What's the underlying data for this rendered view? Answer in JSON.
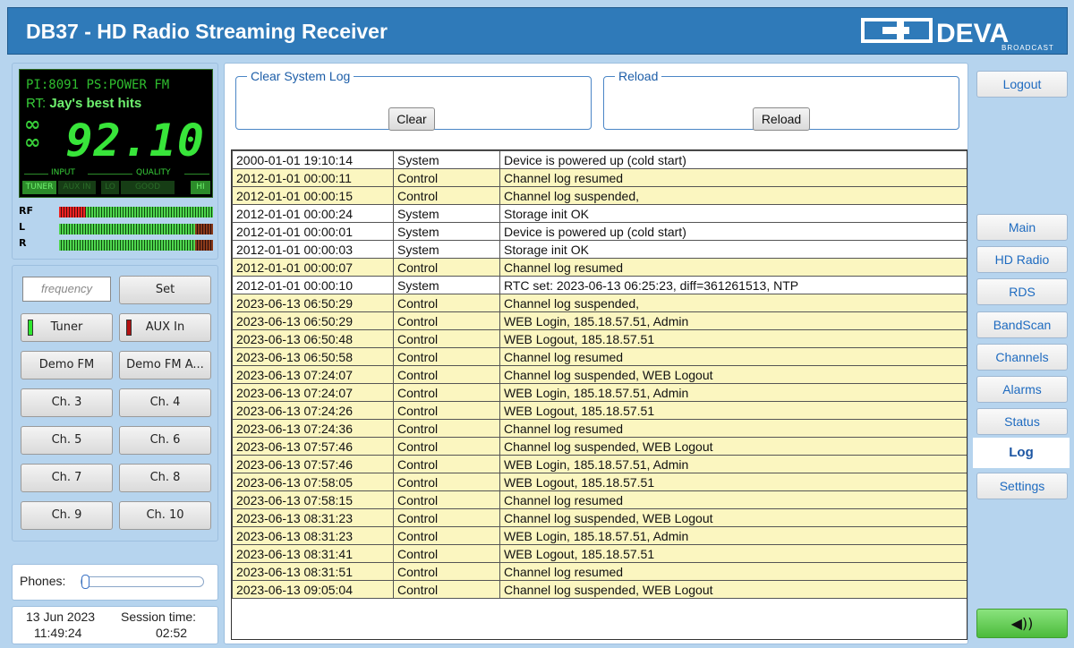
{
  "header": {
    "title": "DB37 - HD Radio Streaming Receiver",
    "brand": "DEVA",
    "brand_sub": "BROADCAST"
  },
  "display": {
    "pi_label": "PI:",
    "pi_value": "8091",
    "ps_label": "PS:",
    "ps_value": "POWER FM",
    "rt_label": "RT:",
    "rt_value": "Jay's best hits",
    "frequency": "92.10",
    "input_label": "INPUT",
    "quality_label": "QUALITY",
    "indicators": [
      "TUNER",
      "AUX IN",
      "LO",
      "GOOD",
      "HI"
    ]
  },
  "meters": {
    "rf_label": "RF",
    "l_label": "L",
    "r_label": "R"
  },
  "presets": {
    "frequency_placeholder": "frequency",
    "set_label": "Set",
    "tuner_label": "Tuner",
    "aux_label": "AUX In",
    "demo_fm": "Demo FM",
    "demo_fm_a": "Demo FM A...",
    "channels": [
      "Ch. 3",
      "Ch. 4",
      "Ch. 5",
      "Ch. 6",
      "Ch. 7",
      "Ch. 8",
      "Ch. 9",
      "Ch. 10"
    ]
  },
  "phones": {
    "label": "Phones:"
  },
  "session": {
    "date": "13 Jun 2023",
    "time": "11:49:24",
    "label": "Session time:",
    "value": "02:52"
  },
  "main": {
    "clear_group": "Clear System Log",
    "clear_button": "Clear",
    "reload_group": "Reload",
    "reload_button": "Reload",
    "log": [
      [
        "2000-01-01 19:10:14",
        "System",
        "Device is powered up (cold start)"
      ],
      [
        "2012-01-01 00:00:11",
        "Control",
        "Channel log resumed"
      ],
      [
        "2012-01-01 00:00:15",
        "Control",
        "Channel log suspended,"
      ],
      [
        "2012-01-01 00:00:24",
        "System",
        "Storage init OK"
      ],
      [
        "2012-01-01 00:00:01",
        "System",
        "Device is powered up (cold start)"
      ],
      [
        "2012-01-01 00:00:03",
        "System",
        "Storage init OK"
      ],
      [
        "2012-01-01 00:00:07",
        "Control",
        "Channel log resumed"
      ],
      [
        "2012-01-01 00:00:10",
        "System",
        "RTC set: 2023-06-13 06:25:23, diff=361261513, NTP"
      ],
      [
        "2023-06-13 06:50:29",
        "Control",
        "Channel log suspended,"
      ],
      [
        "2023-06-13 06:50:29",
        "Control",
        "WEB Login, 185.18.57.51, Admin"
      ],
      [
        "2023-06-13 06:50:48",
        "Control",
        "WEB Logout, 185.18.57.51"
      ],
      [
        "2023-06-13 06:50:58",
        "Control",
        "Channel log resumed"
      ],
      [
        "2023-06-13 07:24:07",
        "Control",
        "Channel log suspended, WEB Logout"
      ],
      [
        "2023-06-13 07:24:07",
        "Control",
        "WEB Login, 185.18.57.51, Admin"
      ],
      [
        "2023-06-13 07:24:26",
        "Control",
        "WEB Logout, 185.18.57.51"
      ],
      [
        "2023-06-13 07:24:36",
        "Control",
        "Channel log resumed"
      ],
      [
        "2023-06-13 07:57:46",
        "Control",
        "Channel log suspended, WEB Logout"
      ],
      [
        "2023-06-13 07:57:46",
        "Control",
        "WEB Login, 185.18.57.51, Admin"
      ],
      [
        "2023-06-13 07:58:05",
        "Control",
        "WEB Logout, 185.18.57.51"
      ],
      [
        "2023-06-13 07:58:15",
        "Control",
        "Channel log resumed"
      ],
      [
        "2023-06-13 08:31:23",
        "Control",
        "Channel log suspended, WEB Logout"
      ],
      [
        "2023-06-13 08:31:23",
        "Control",
        "WEB Login, 185.18.57.51, Admin"
      ],
      [
        "2023-06-13 08:31:41",
        "Control",
        "WEB Logout, 185.18.57.51"
      ],
      [
        "2023-06-13 08:31:51",
        "Control",
        "Channel log resumed"
      ],
      [
        "2023-06-13 09:05:04",
        "Control",
        "Channel log suspended, WEB Logout"
      ]
    ]
  },
  "nav": {
    "logout": "Logout",
    "items": [
      "Main",
      "HD Radio",
      "RDS",
      "BandScan",
      "Channels",
      "Alarms",
      "Status",
      "Log",
      "Settings"
    ],
    "active": "Log",
    "speaker_icon": "speaker-icon"
  },
  "colors": {
    "header": "#2f7ab9",
    "lcd_green": "#38e53a",
    "control_row": "#fbf6c0",
    "link": "#1e6bc0"
  }
}
